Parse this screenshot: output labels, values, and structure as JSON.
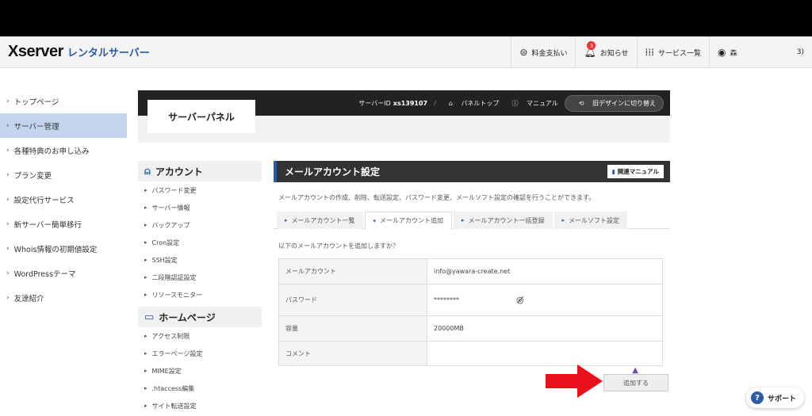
{
  "header": {
    "logo_main": "Xserver",
    "logo_sub": "レンタルサーバー",
    "nav": [
      {
        "label": "料金支払い",
        "icon": "yen-icon"
      },
      {
        "label": "お知らせ",
        "icon": "bell-icon",
        "badge": "3"
      },
      {
        "label": "サービス一覧",
        "icon": "grid-icon"
      },
      {
        "label": "森",
        "icon": "user-icon",
        "suffix": "3)"
      }
    ]
  },
  "sidebar": {
    "items": [
      {
        "label": "トップページ"
      },
      {
        "label": "サーバー管理"
      },
      {
        "label": "各種特典のお申し込み"
      },
      {
        "label": "プラン変更"
      },
      {
        "label": "設定代行サービス"
      },
      {
        "label": "新サーバー簡単移行"
      },
      {
        "label": "Whois情報の初期値設定"
      },
      {
        "label": "WordPressテーマ"
      },
      {
        "label": "友達紹介"
      }
    ]
  },
  "panel": {
    "title": "サーバーパネル",
    "server_id_label": "サーバーID",
    "server_id": "xs139107",
    "separator": "/",
    "top_link": "パネルトップ",
    "manual_link": "マニュアル",
    "old_design": "旧デザインに切り替え"
  },
  "subside": {
    "account_head": "アカウント",
    "account_items": [
      "パスワード変更",
      "サーバー情報",
      "バックアップ",
      "Cron設定",
      "SSH設定",
      "二段階認証設定",
      "リソースモニター"
    ],
    "homepage_head": "ホームページ",
    "homepage_items": [
      "アクセス制限",
      "エラーページ設定",
      "MIME設定",
      ".htaccess編集",
      "サイト転送設定"
    ]
  },
  "main": {
    "title": "メールアカウント設定",
    "manual_btn": "関連マニュアル",
    "description": "メールアカウントの作成、削除、転送設定、パスワード変更、メールソフト設定の確認を行うことができます。",
    "tabs": [
      {
        "label": "メールアカウント一覧"
      },
      {
        "label": "メールアカウント追加"
      },
      {
        "label": "メールアカウント一括登録"
      },
      {
        "label": "メールソフト設定"
      }
    ],
    "question": "以下のメールアカウントを追加しますか？",
    "rows": [
      {
        "label": "メールアカウント",
        "value": "info@yawara-create.net"
      },
      {
        "label": "パスワード",
        "value": "********"
      },
      {
        "label": "容量",
        "value": "20000MB"
      },
      {
        "label": "コメント",
        "value": ""
      }
    ],
    "submit": "追加する"
  },
  "support": {
    "label": "サポート"
  },
  "colors": {
    "accent": "#2a5aa8",
    "arrow": "#e8101a",
    "active_side": "#c4d4ec"
  }
}
